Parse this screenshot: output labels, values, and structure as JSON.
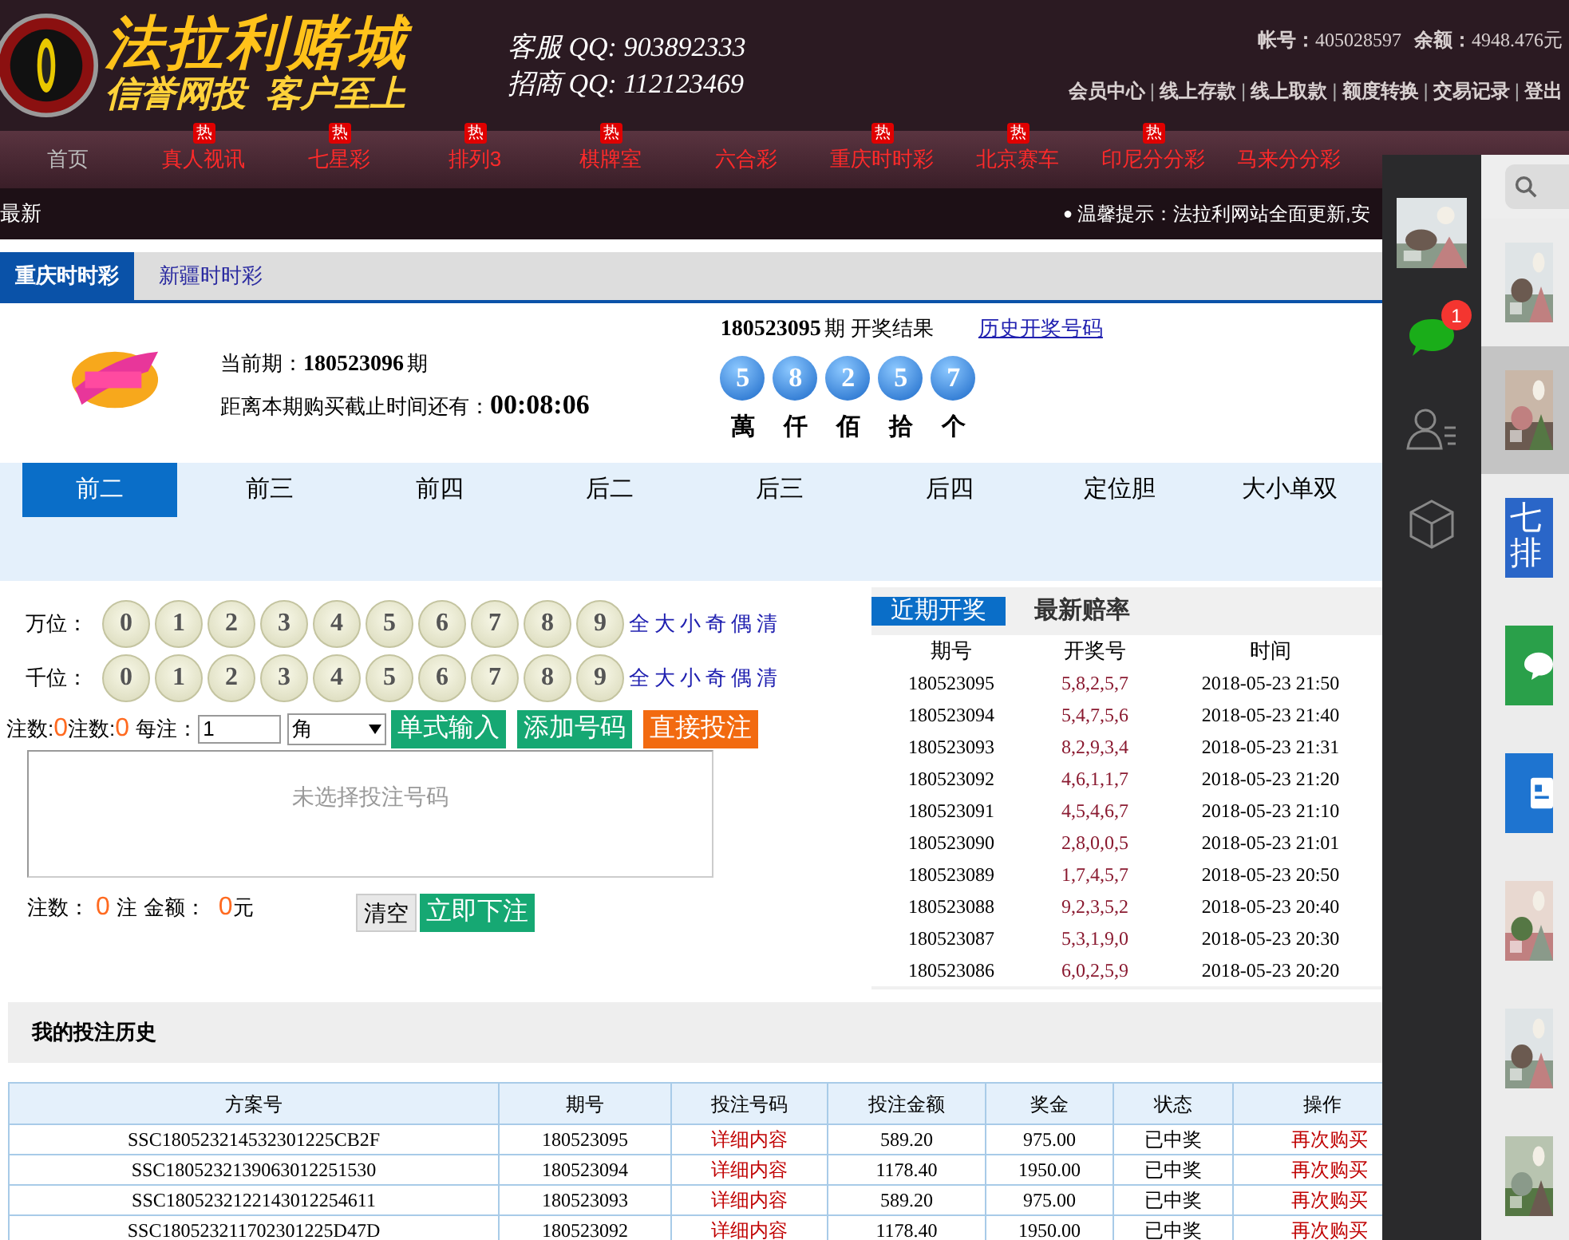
{
  "header": {
    "title": "法拉利赌城",
    "slogan": "信誉网投  客户至上",
    "qq": [
      {
        "label": "客服 QQ:",
        "value": "903892333"
      },
      {
        "label": "招商 QQ:",
        "value": "112123469"
      }
    ],
    "account": {
      "label": "帐号：",
      "value": "405028597",
      "balance_label": "余额：",
      "balance": "4948.476元"
    },
    "links": [
      {
        "label": "会员中心"
      },
      {
        "separator": "|",
        "label": "线上存款"
      },
      {
        "separator": "|",
        "label": "线上取款"
      },
      {
        "separator": "|",
        "label": "额度转换"
      },
      {
        "separator": "|",
        "label": "交易记录"
      },
      {
        "separator": "|",
        "label": "登出"
      }
    ]
  },
  "nav": [
    {
      "label": "首页",
      "selected": true
    },
    {
      "label": "真人视讯",
      "selected": false,
      "badge": "热"
    },
    {
      "label": "七星彩",
      "selected": false,
      "badge": "热"
    },
    {
      "label": "排列3",
      "selected": false,
      "badge": "热"
    },
    {
      "label": "棋牌室",
      "selected": false,
      "badge": "热"
    },
    {
      "label": "六合彩",
      "selected": false
    },
    {
      "label": "重庆时时彩",
      "selected": false,
      "badge": "热"
    },
    {
      "label": "北京赛车",
      "selected": false,
      "badge": "热"
    },
    {
      "label": "印尼分分彩",
      "selected": false,
      "badge": "热"
    },
    {
      "label": "马来分分彩",
      "selected": false
    }
  ],
  "ticker": {
    "label": "最新",
    "bullet": "●",
    "text": "温馨提示：法拉利网站全面更新,安"
  },
  "game_tabs": [
    {
      "label": "重庆时时彩",
      "selected": true
    },
    {
      "label": "新疆时时彩",
      "selected": false
    }
  ],
  "draw": {
    "current_label": "当前期：",
    "current": "180523096",
    "period_unit": "期",
    "countdown_label": "距离本期购买截止时间还有：",
    "countdown": "00:08:06",
    "last": "180523095",
    "last_suffix": "期 开奖结果",
    "history_link": "历史开奖号码",
    "balls": [
      "5",
      "8",
      "2",
      "5",
      "7"
    ],
    "positions": [
      "萬",
      "仟",
      "佰",
      "拾",
      "个"
    ]
  },
  "play_tabs": [
    {
      "label": "前二",
      "selected": true
    },
    {
      "label": "前三",
      "selected": false
    },
    {
      "label": "前四",
      "selected": false
    },
    {
      "label": "后二",
      "selected": false
    },
    {
      "label": "后三",
      "selected": false
    },
    {
      "label": "后四",
      "selected": false
    },
    {
      "label": "定位胆",
      "selected": false
    },
    {
      "label": "大小单双",
      "selected": false
    }
  ],
  "pick_rows": [
    {
      "label": "万位：",
      "digits": [
        "0",
        "1",
        "2",
        "3",
        "4",
        "5",
        "6",
        "7",
        "8",
        "9"
      ],
      "quick": [
        "全",
        "大",
        "小",
        "奇",
        "偶",
        "清"
      ]
    },
    {
      "label": "千位：",
      "digits": [
        "0",
        "1",
        "2",
        "3",
        "4",
        "5",
        "6",
        "7",
        "8",
        "9"
      ],
      "quick": [
        "全",
        "大",
        "小",
        "奇",
        "偶",
        "清"
      ]
    }
  ],
  "bet_bar": {
    "count_label": "注数:",
    "count": "0",
    "count_label_2": "注数:",
    "count_2": "0",
    "unit_label": "每注：",
    "unit_value": "1",
    "unit_select": "角",
    "buttons": [
      {
        "label": "单式输入",
        "kind": "primary"
      },
      {
        "label": "添加号码",
        "kind": "primary"
      },
      {
        "label": "直接投注",
        "kind": "warning"
      }
    ]
  },
  "bet_area": {
    "placeholder": "未选择投注号码"
  },
  "totals": {
    "count_label": "注数：",
    "count": "0",
    "count_unit": "注",
    "amount_label": "金额：",
    "amount": "0",
    "amount_unit": "元",
    "buttons": [
      {
        "label": "清空",
        "kind": "plain"
      },
      {
        "label": "立即下注",
        "kind": "primary"
      }
    ]
  },
  "recent_tabs": [
    {
      "label": "近期开奖",
      "selected": true
    },
    {
      "label": "最新赔率",
      "selected": false
    }
  ],
  "recent": {
    "columns": [
      "期号",
      "开奖号",
      "时间"
    ],
    "rows": [
      [
        "180523095",
        "5,8,2,5,7",
        "2018-05-23 21:50"
      ],
      [
        "180523094",
        "5,4,7,5,6",
        "2018-05-23 21:40"
      ],
      [
        "180523093",
        "8,2,9,3,4",
        "2018-05-23 21:31"
      ],
      [
        "180523092",
        "4,6,1,1,7",
        "2018-05-23 21:20"
      ],
      [
        "180523091",
        "4,5,4,6,7",
        "2018-05-23 21:10"
      ],
      [
        "180523090",
        "2,8,0,0,5",
        "2018-05-23 21:01"
      ],
      [
        "180523089",
        "1,7,4,5,7",
        "2018-05-23 20:50"
      ],
      [
        "180523088",
        "9,2,3,5,2",
        "2018-05-23 20:40"
      ],
      [
        "180523087",
        "5,3,1,9,0",
        "2018-05-23 20:30"
      ],
      [
        "180523086",
        "6,0,2,5,9",
        "2018-05-23 20:20"
      ]
    ]
  },
  "history": {
    "title": "我的投注历史",
    "columns": [
      "方案号",
      "期号",
      "投注号码",
      "投注金额",
      "奖金",
      "状态",
      "操作"
    ],
    "rows": [
      {
        "id": "SSC180523214532301225CB2F",
        "period": "180523095",
        "detail": "详细内容",
        "amount": "589.20",
        "prize": "975.00",
        "status": "已中奖",
        "action": "再次购买"
      },
      {
        "id": "SSC1805232139063012251530",
        "period": "180523094",
        "detail": "详细内容",
        "amount": "1178.40",
        "prize": "1950.00",
        "status": "已中奖",
        "action": "再次购买"
      },
      {
        "id": "SSC1805232122143012254611",
        "period": "180523093",
        "detail": "详细内容",
        "amount": "589.20",
        "prize": "975.00",
        "status": "已中奖",
        "action": "再次购买"
      },
      {
        "id": "SSC180523211702301225D47D",
        "period": "180523092",
        "detail": "详细内容",
        "amount": "1178.40",
        "prize": "1950.00",
        "status": "已中奖",
        "action": "再次购买"
      }
    ]
  },
  "chat": {
    "unread": "1",
    "items": [
      {
        "kind": "picture",
        "selected": false
      },
      {
        "kind": "picture",
        "selected": true
      },
      {
        "kind": "text",
        "text": "七排",
        "selected": false
      },
      {
        "kind": "chat",
        "selected": false
      },
      {
        "kind": "document",
        "selected": false
      },
      {
        "kind": "picture",
        "selected": false
      },
      {
        "kind": "picture",
        "selected": false
      },
      {
        "kind": "picture",
        "selected": false
      }
    ]
  }
}
